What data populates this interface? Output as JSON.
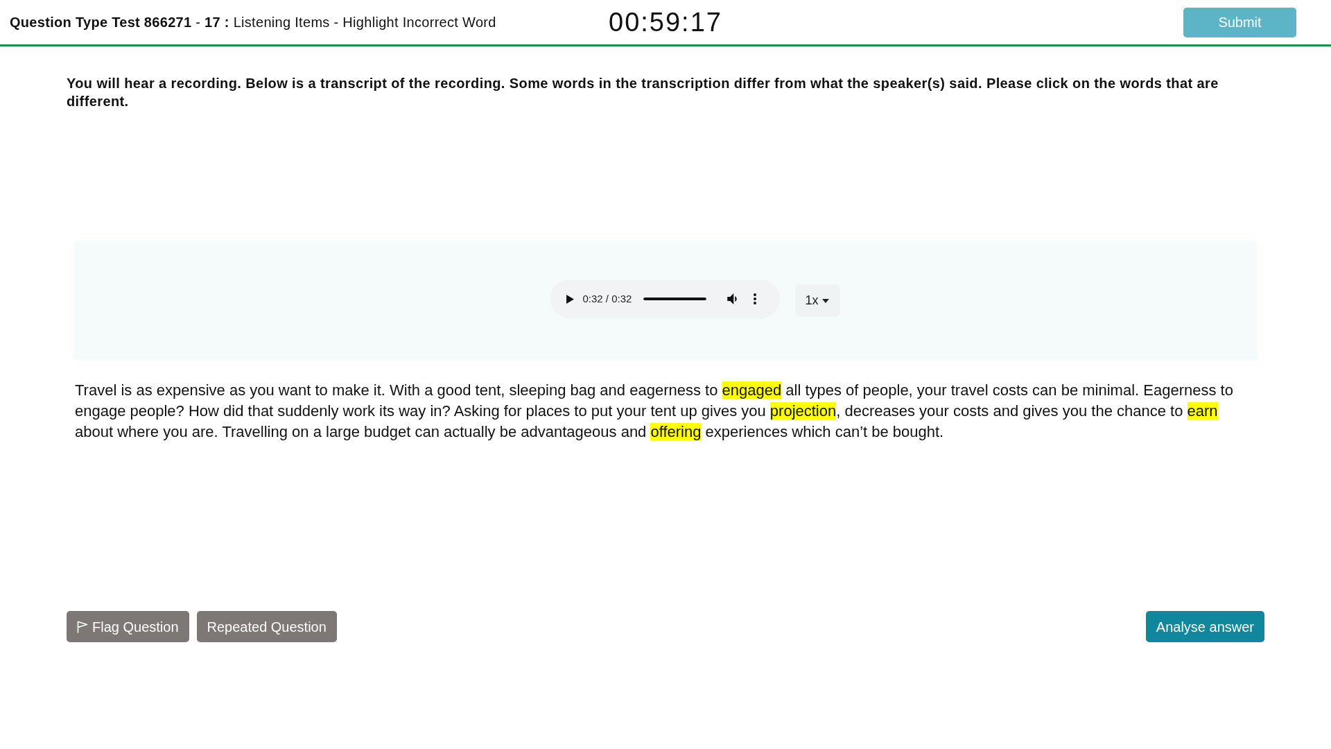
{
  "header": {
    "title": "**Question Type Test 866271** - **17 :** Listening Items - Highlight Incorrect Word",
    "timer": "00:59:17",
    "submit_button": "Submit"
  },
  "instructions": "You will hear a recording. Below is a transcript of the recording. Some words in the transcription differ from what the speaker(s) said. Please click on the words that are different.",
  "audio_player": {
    "time": "0:32 / 0:32",
    "level": 1,
    "speed": "1x"
  },
  "transcript": {
    "segments": [
      {
        "text": "Travel is as expensive as you want to make it. With a good tent, sleeping bag and eagerness to ",
        "selected": false
      },
      {
        "text": "engaged",
        "selected": true
      },
      {
        "text": " all types of people, your travel costs can be minimal. Eagerness to engage people? How did that suddenly work its way in? Asking for places to put your tent up gives you ",
        "selected": false
      },
      {
        "text": "projection",
        "selected": true
      },
      {
        "text": ", decreases your costs and gives you the chance to ",
        "selected": false
      },
      {
        "text": "earn",
        "selected": true
      },
      {
        "text": " about where you are. Travelling on a large budget can actually be advantageous and ",
        "selected": false
      },
      {
        "text": "offering",
        "selected": true
      },
      {
        "text": " experiences which can’t be bought.",
        "selected": false
      }
    ]
  },
  "buttons": [
    {
      "label": "Flag Question",
      "kind": "flag"
    },
    {
      "label": "Repeated Question",
      "kind": "secondary"
    },
    {
      "label": "Analyse answer",
      "kind": "primary"
    }
  ]
}
